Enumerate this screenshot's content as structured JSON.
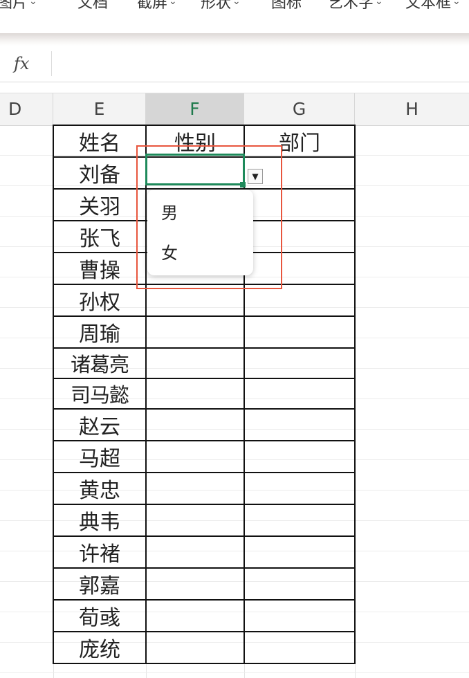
{
  "toolbar": {
    "items": [
      {
        "label": "图片"
      },
      {
        "label": "文档"
      },
      {
        "label": "截屏"
      },
      {
        "label": "形状"
      },
      {
        "label": "图标"
      },
      {
        "label": "艺术字"
      },
      {
        "label": "文本框"
      }
    ]
  },
  "formula_bar": {
    "fx_label": "fx",
    "value": ""
  },
  "columns": [
    "D",
    "E",
    "F",
    "G",
    "H"
  ],
  "active_column": "F",
  "table": {
    "headers": [
      "姓名",
      "性别",
      "部门"
    ],
    "rows": [
      {
        "name": "刘备"
      },
      {
        "name": "关羽"
      },
      {
        "name": "张飞"
      },
      {
        "name": "曹操"
      },
      {
        "name": "孙权"
      },
      {
        "name": "周瑜"
      },
      {
        "name": "诸葛亮"
      },
      {
        "name": "司马懿"
      },
      {
        "name": "赵云"
      },
      {
        "name": "马超"
      },
      {
        "name": "黄忠"
      },
      {
        "name": "典韦"
      },
      {
        "name": "许褚"
      },
      {
        "name": "郭嘉"
      },
      {
        "name": "荀彧"
      },
      {
        "name": "庞统"
      }
    ]
  },
  "dropdown": {
    "options": [
      "男",
      "女"
    ]
  },
  "colors": {
    "selection": "#1e8a5b",
    "highlight": "#e8553d"
  }
}
